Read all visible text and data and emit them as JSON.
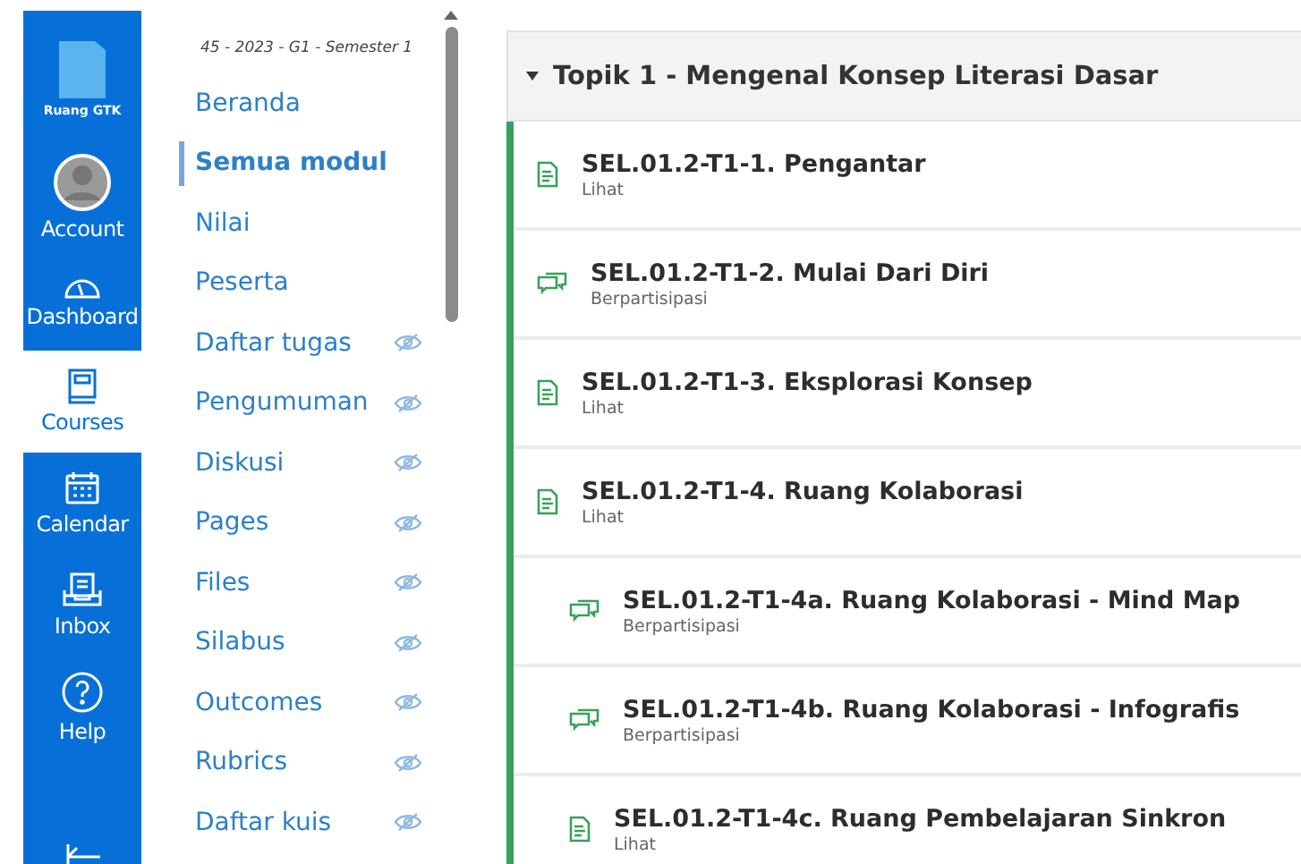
{
  "global_nav": {
    "logo_label": "Ruang GTK",
    "items": [
      {
        "label": "Account",
        "kind": "account",
        "selected": false
      },
      {
        "label": "Dashboard",
        "kind": "dashboard",
        "selected": false
      },
      {
        "label": "Courses",
        "kind": "courses",
        "selected": true
      },
      {
        "label": "Calendar",
        "kind": "calendar",
        "selected": false
      },
      {
        "label": "Inbox",
        "kind": "inbox",
        "selected": false
      },
      {
        "label": "Help",
        "kind": "help",
        "selected": false
      }
    ]
  },
  "course_nav": {
    "term": "45 - 2023 - G1 - Semester 1",
    "items": [
      {
        "label": "Beranda",
        "selected": false,
        "hidden": false
      },
      {
        "label": "Semua modul",
        "selected": true,
        "hidden": false
      },
      {
        "label": "Nilai",
        "selected": false,
        "hidden": false
      },
      {
        "label": "Peserta",
        "selected": false,
        "hidden": false
      },
      {
        "label": "Daftar tugas",
        "selected": false,
        "hidden": true
      },
      {
        "label": "Pengumuman",
        "selected": false,
        "hidden": true
      },
      {
        "label": "Diskusi",
        "selected": false,
        "hidden": true
      },
      {
        "label": "Pages",
        "selected": false,
        "hidden": true
      },
      {
        "label": "Files",
        "selected": false,
        "hidden": true
      },
      {
        "label": "Silabus",
        "selected": false,
        "hidden": true
      },
      {
        "label": "Outcomes",
        "selected": false,
        "hidden": true
      },
      {
        "label": "Rubrics",
        "selected": false,
        "hidden": true
      },
      {
        "label": "Daftar kuis",
        "selected": false,
        "hidden": true
      }
    ]
  },
  "module": {
    "title": "Topik 1 - Mengenal Konsep Literasi Dasar",
    "expanded": true,
    "items": [
      {
        "kind": "page",
        "title": "SEL.01.2-T1-1. Pengantar",
        "requirement": "Lihat"
      },
      {
        "kind": "discussion",
        "title": "SEL.01.2-T1-2. Mulai Dari Diri",
        "requirement": "Berpartisipasi"
      },
      {
        "kind": "page",
        "title": "SEL.01.2-T1-3. Eksplorasi Konsep",
        "requirement": "Lihat"
      },
      {
        "kind": "page",
        "title": "SEL.01.2-T1-4. Ruang Kolaborasi",
        "requirement": "Lihat",
        "children": [
          {
            "kind": "discussion",
            "title": "SEL.01.2-T1-4a. Ruang Kolaborasi - Mind Map",
            "requirement": "Berpartisipasi"
          },
          {
            "kind": "discussion",
            "title": "SEL.01.2-T1-4b. Ruang Kolaborasi - Infografis",
            "requirement": "Berpartisipasi"
          },
          {
            "kind": "page",
            "title": "SEL.01.2-T1-4c. Ruang Pembelajaran Sinkron",
            "requirement": "Lihat"
          }
        ]
      }
    ]
  }
}
